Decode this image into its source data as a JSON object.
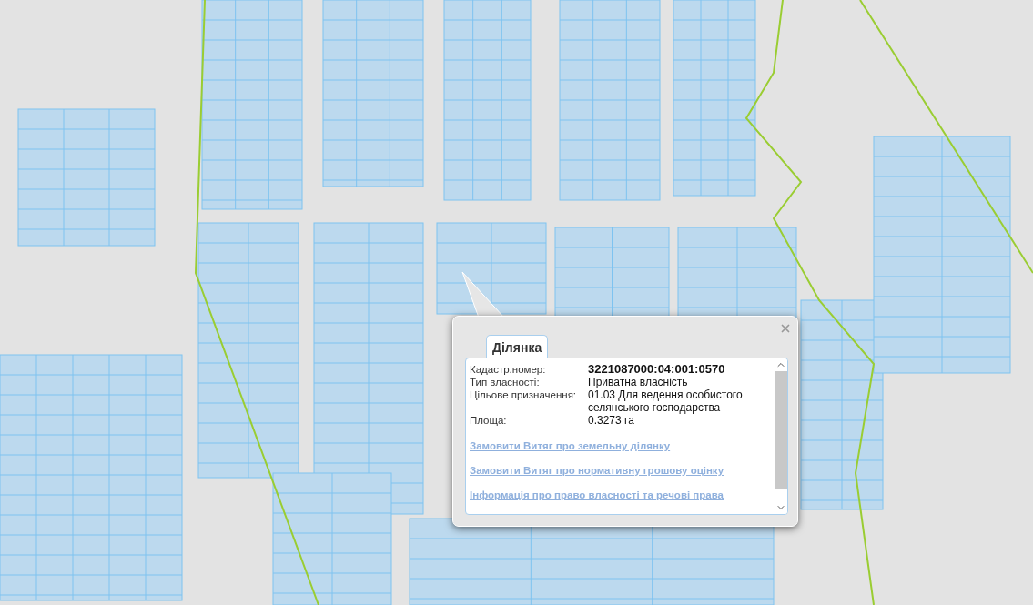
{
  "popup": {
    "tabs": [
      {
        "label": "Ділянка",
        "selected": true
      }
    ],
    "fields": [
      {
        "label": "Кадастр.номер:",
        "value": "3221087000:04:001:0570",
        "emphasis": true
      },
      {
        "label": "Тип власності:",
        "value": "Приватна власність",
        "emphasis": false
      },
      {
        "label": "Цільове призначення:",
        "value": "01.03 Для ведення особистого селянського господарства",
        "emphasis": false
      },
      {
        "label": "Площа:",
        "value": "0.3273 га",
        "emphasis": false
      }
    ],
    "links": [
      "Замовити Витяг про земельну ділянку",
      "Замовити Витяг про нормативну грошову оцінку",
      "Інформація про право власності та речові права"
    ]
  }
}
